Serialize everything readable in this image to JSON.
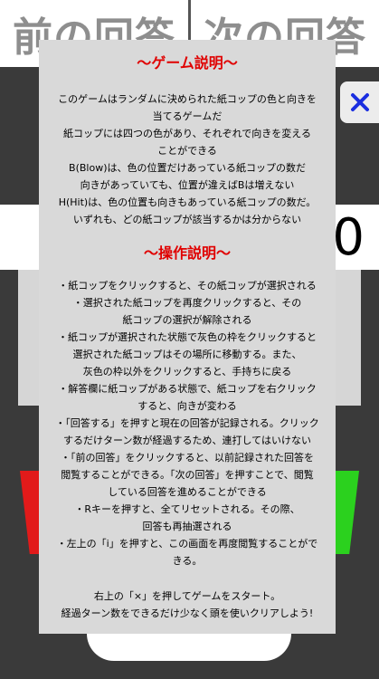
{
  "top_bar": {
    "prev_answer_label": "前の回答",
    "next_answer_label": "次の回答"
  },
  "turn_counter": "0",
  "close_icon": "close-x-icon",
  "colors": {
    "title_red": "#e00000",
    "close_blue": "#1a2ee0",
    "cup_red": "#e21a1a",
    "cup_green": "#2bd11e"
  },
  "help": {
    "game_title": "〜ゲーム説明〜",
    "game_lines": [
      "このゲームはランダムに決められた紙コップの色と向きを",
      "当てるゲームだ",
      "紙コップには四つの色があり、それぞれで向きを変える",
      "ことができる",
      "B(Blow)は、色の位置だけあっている紙コップの数だ",
      "向きがあっていても、位置が違えばBは増えない",
      "H(Hit)は、色の位置も向きもあっている紙コップの数だ。",
      "いずれも、どの紙コップが該当するかは分からない"
    ],
    "ops_title": "〜操作説明〜",
    "ops_items": [
      "・紙コップをクリックすると、その紙コップが選択される",
      "・選択された紙コップを再度クリックすると、その",
      "紙コップの選択が解除される",
      "・紙コップが選択された状態で灰色の枠をクリックすると",
      "選択された紙コップはその場所に移動する。また、",
      "灰色の枠以外をクリックすると、手持ちに戻る",
      "・解答欄に紙コップがある状態で、紙コップを右クリック",
      "すると、向きが変わる",
      "・「回答する」を押すと現在の回答が記録される。クリック",
      "するだけターン数が経過するため、連打してはいけない",
      "・「前の回答」をクリックすると、以前記録された回答を",
      "閲覧することができる。「次の回答」を押すことで、閲覧",
      "している回答を進めることができる",
      "・Rキーを押すと、全てリセットされる。その際、",
      "回答も再抽選される",
      "・左上の「i」を押すと、この画面を再度閲覧することがで",
      "きる。"
    ],
    "footer_lines": [
      "右上の「×」を押してゲームをスタート。",
      "経過ターン数をできるだけ少なく頭を使いクリアしよう!"
    ]
  }
}
